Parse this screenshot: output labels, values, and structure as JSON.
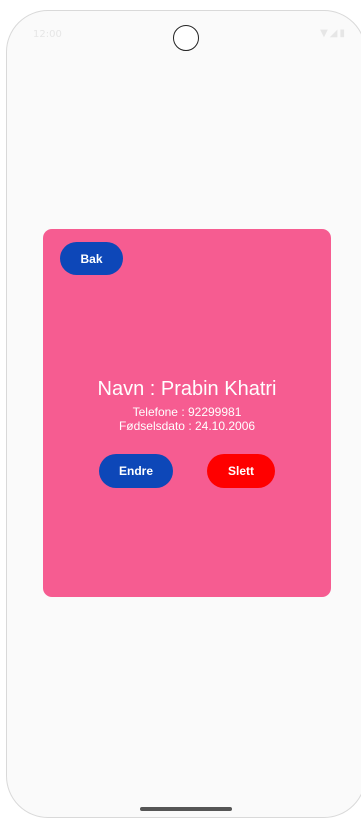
{
  "status_bar": {
    "time": "12:00",
    "icons": "▼◢▮"
  },
  "card": {
    "back_label": "Bak",
    "name_text": "Navn : Prabin Khatri",
    "phone_text": "Telefone : 92299981",
    "birth_text": "Fødselsdato : 24.10.2006",
    "edit_label": "Endre",
    "delete_label": "Slett"
  },
  "colors": {
    "card_bg": "#f65c91",
    "primary_button": "#0d47b8",
    "delete_button": "#ff0000"
  }
}
